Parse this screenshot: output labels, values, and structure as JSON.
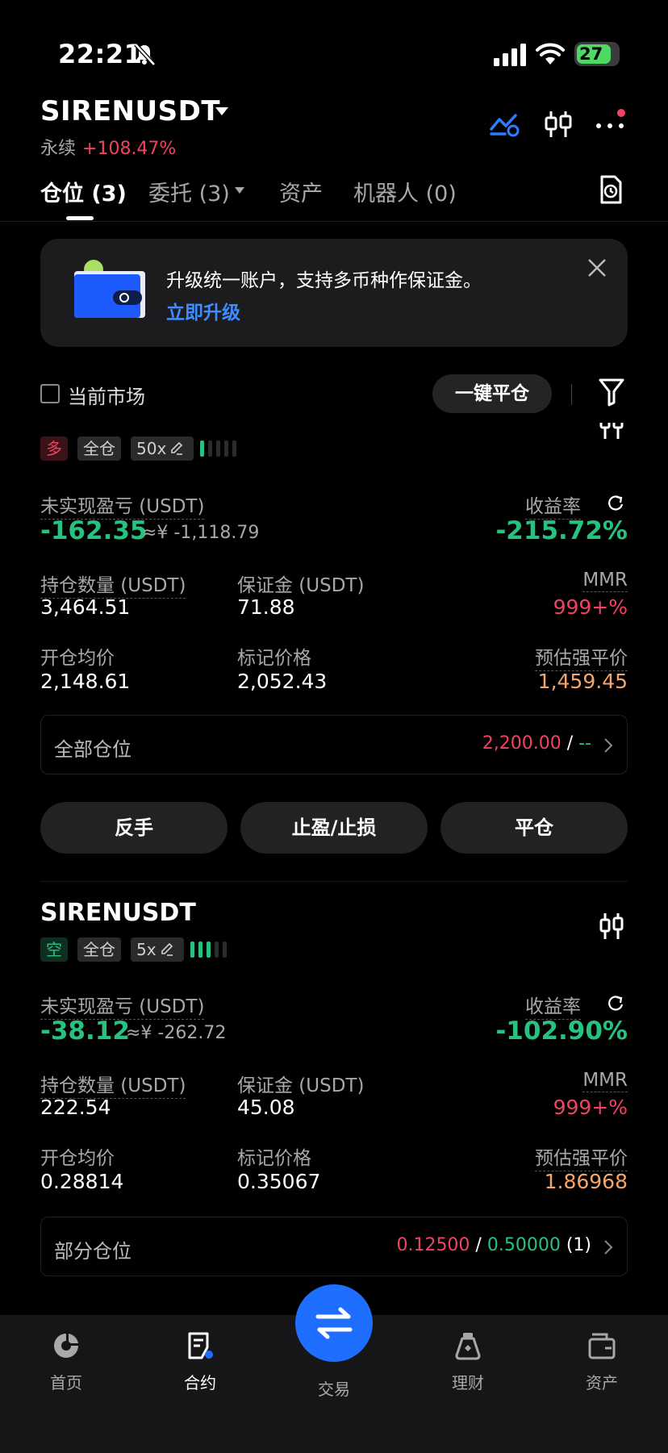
{
  "status_bar": {
    "time": "22:21",
    "battery": "27"
  },
  "header": {
    "symbol": "SIRENUSDT",
    "type": "永续",
    "change": "+108.47%"
  },
  "tabs": [
    {
      "label": "仓位 (3)"
    },
    {
      "label": "委托 (3)"
    },
    {
      "label": "资产"
    },
    {
      "label": "机器人 (0)"
    }
  ],
  "banner": {
    "text": "升级统一账户，支持多币种作保证金。",
    "link": "立即升级"
  },
  "filter": {
    "current_market": "当前市场",
    "close_all": "一键平仓"
  },
  "positions": [
    {
      "side": "多",
      "margin_mode": "全仓",
      "leverage": "50x",
      "risk_level": 1,
      "pnl_label": "未实现盈亏 (USDT)",
      "pnl": "-162.35",
      "pnl_cny": "≈¥ -1,118.79",
      "roi_label": "收益率",
      "roi": "-215.72%",
      "size_label": "持仓数量 (USDT)",
      "size": "3,464.51",
      "margin_label": "保证金 (USDT)",
      "margin": "71.88",
      "mmr_label": "MMR",
      "mmr": "999+%",
      "entry_label": "开仓均价",
      "entry": "2,148.61",
      "mark_label": "标记价格",
      "mark": "2,052.43",
      "liq_label": "预估强平价",
      "liq": "1,459.45",
      "tpsl_scope": "全部仓位",
      "tp": "2,200.00",
      "sl": "--",
      "tpsl_count": ""
    },
    {
      "symbol": "SIRENUSDT",
      "side": "空",
      "margin_mode": "全仓",
      "leverage": "5x",
      "risk_level": 3,
      "pnl_label": "未实现盈亏 (USDT)",
      "pnl": "-38.12",
      "pnl_cny": "≈¥ -262.72",
      "roi_label": "收益率",
      "roi": "-102.90%",
      "size_label": "持仓数量 (USDT)",
      "size": "222.54",
      "margin_label": "保证金 (USDT)",
      "margin": "45.08",
      "mmr_label": "MMR",
      "mmr": "999+%",
      "entry_label": "开仓均价",
      "entry": "0.28814",
      "mark_label": "标记价格",
      "mark": "0.35067",
      "liq_label": "预估强平价",
      "liq": "1.86968",
      "tpsl_scope": "部分仓位",
      "tp": "0.12500",
      "sl": "0.50000",
      "tpsl_count": "(1)"
    }
  ],
  "actions": {
    "reverse": "反手",
    "tpsl": "止盈/止损",
    "close": "平仓"
  },
  "nav": [
    {
      "label": "首页",
      "icon": "home-icon"
    },
    {
      "label": "合约",
      "icon": "contract-icon"
    },
    {
      "label": "交易",
      "icon": "trade-icon"
    },
    {
      "label": "理财",
      "icon": "finance-icon"
    },
    {
      "label": "资产",
      "icon": "assets-icon"
    }
  ],
  "colors": {
    "up": "#f0435f",
    "down": "#27c27f",
    "accent": "#1e6fff",
    "liq": "#f5a56a"
  }
}
